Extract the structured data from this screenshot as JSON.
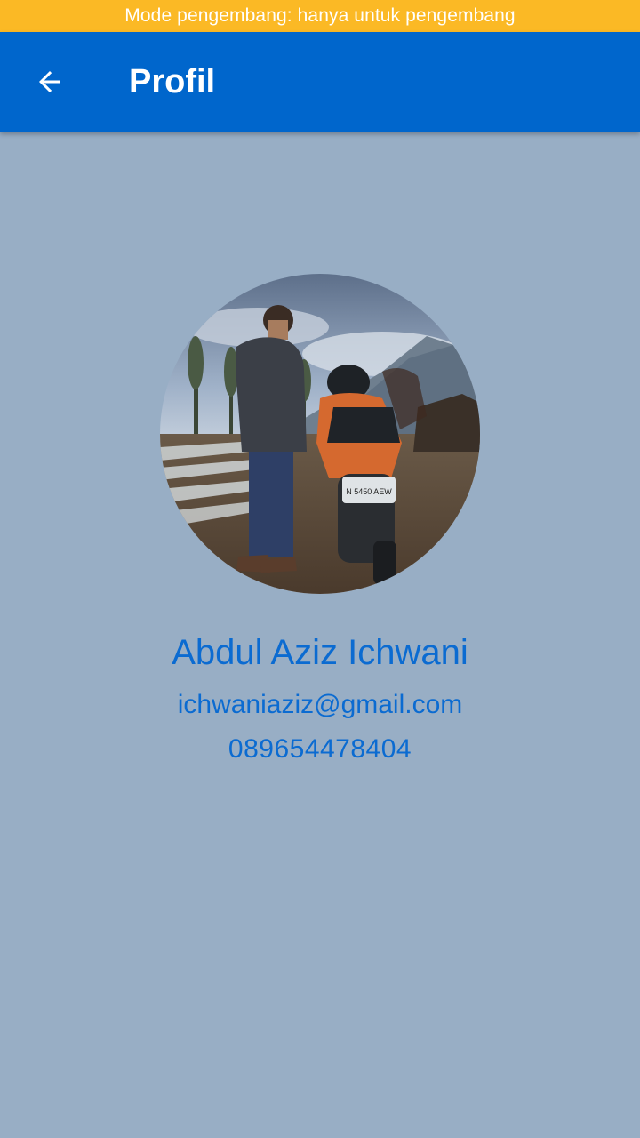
{
  "status_banner": {
    "text": "Mode pengembang: hanya untuk pengembang",
    "color": "#fbb925"
  },
  "app_bar": {
    "title": "Profil",
    "back_icon": "arrow-left-icon",
    "color": "#0066cc"
  },
  "profile": {
    "name": "Abdul Aziz Ichwani",
    "email": "ichwaniaziz@gmail.com",
    "phone": "089654478404",
    "text_color": "#0b6bd1",
    "photo": {
      "plate_text": "N 5450 AEW"
    }
  },
  "background_color": "#98aec5"
}
